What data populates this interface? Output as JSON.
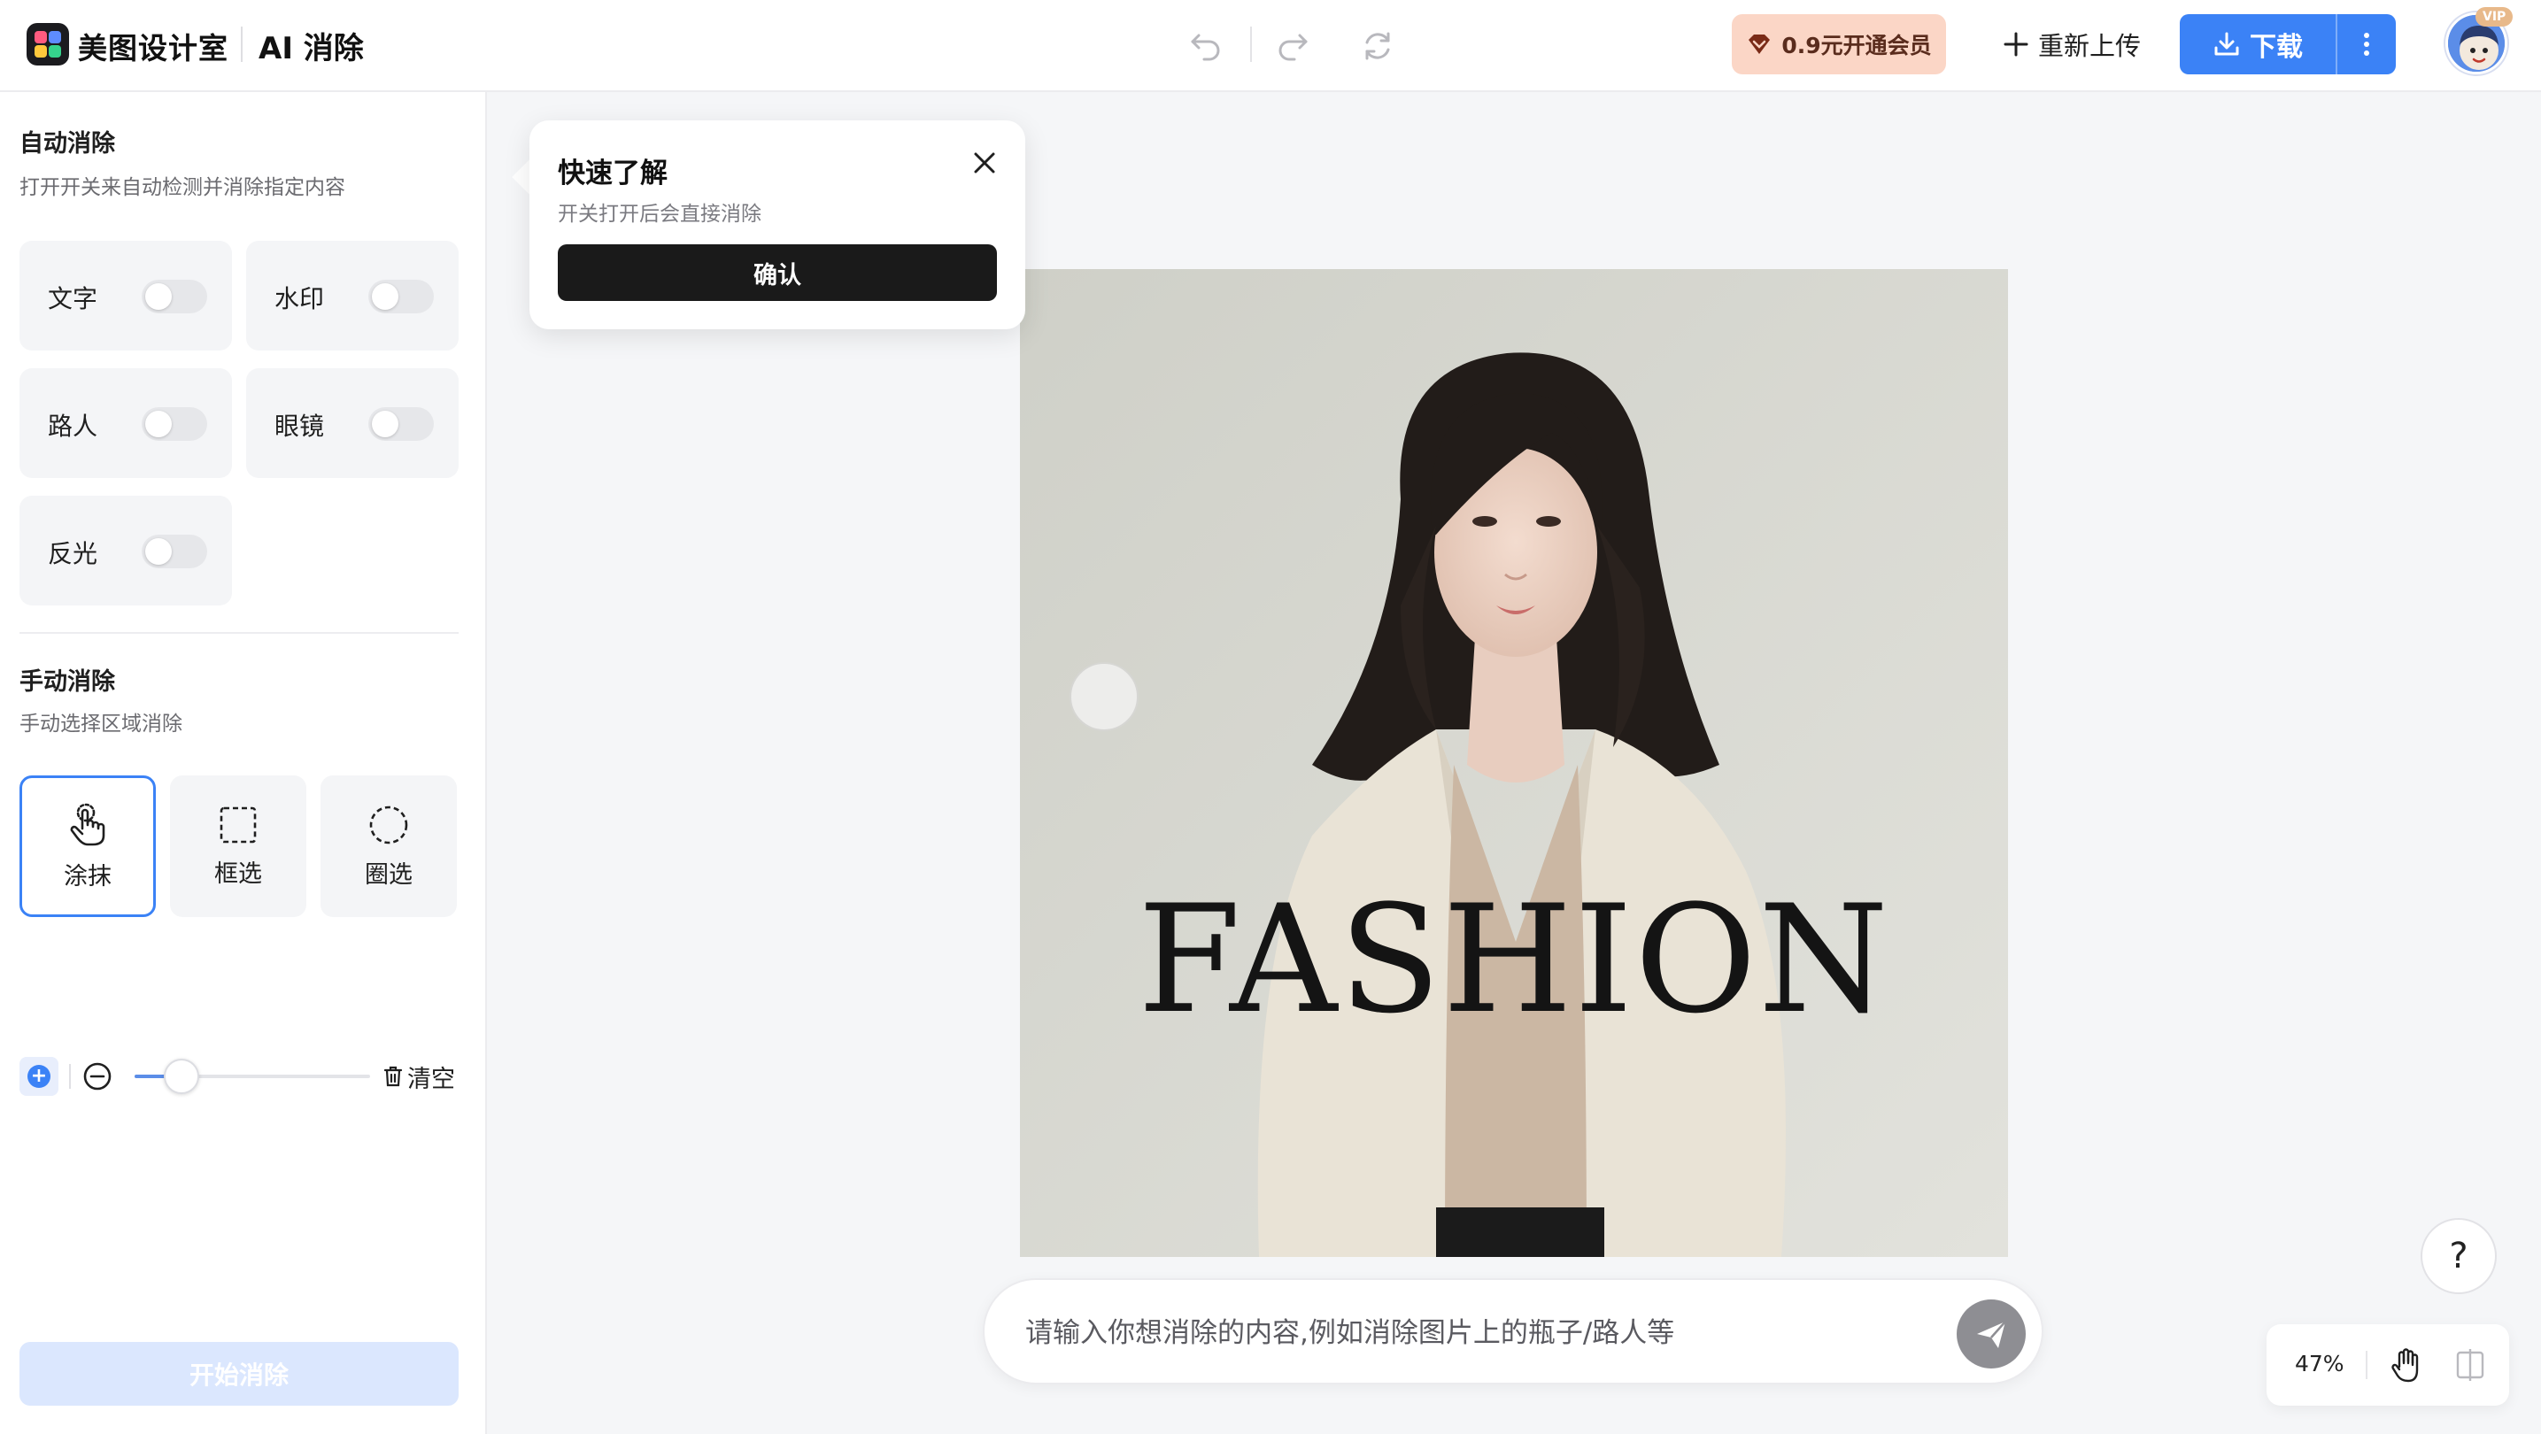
{
  "header": {
    "brand": "美图设计室",
    "product": "AI 消除",
    "vip_button": "0.9元开通会员",
    "reupload_button": "重新上传",
    "download_button": "下载",
    "vip_tag": "VIP"
  },
  "sidebar": {
    "auto_title": "自动消除",
    "auto_subtitle": "打开开关来自动检测并消除指定内容",
    "toggles": [
      {
        "label": "文字",
        "on": false
      },
      {
        "label": "水印",
        "on": false
      },
      {
        "label": "路人",
        "on": false
      },
      {
        "label": "眼镜",
        "on": false
      },
      {
        "label": "反光",
        "on": false
      }
    ],
    "manual_title": "手动消除",
    "manual_subtitle": "手动选择区域消除",
    "tools": [
      {
        "label": "涂抹",
        "active": true
      },
      {
        "label": "框选",
        "active": false
      },
      {
        "label": "圈选",
        "active": false
      }
    ],
    "brush_size_fraction": 0.2,
    "clear_button": "清空",
    "start_button": "开始消除"
  },
  "popover": {
    "title": "快速了解",
    "subtitle": "开关打开后会直接消除",
    "confirm_button": "确认"
  },
  "canvas": {
    "image_text": "FASHION"
  },
  "prompt": {
    "placeholder": "请输入你想消除的内容,例如消除图片上的瓶子/路人等",
    "value": ""
  },
  "zoom": {
    "level": "47%"
  },
  "help_button": "?",
  "colors": {
    "accent": "#3b82f6",
    "vip_bg": "#fbd6c6",
    "start_disabled": "#dbe7fe"
  }
}
